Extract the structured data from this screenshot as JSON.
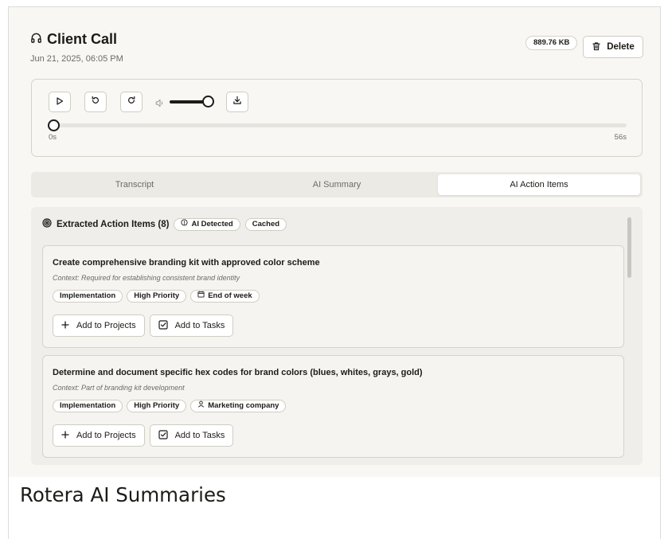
{
  "recording": {
    "title": "Client Call",
    "date": "Jun 21, 2025, 06:05 PM",
    "file_size": "889.76 KB",
    "delete_label": "Delete"
  },
  "player": {
    "time_start": "0s",
    "time_end": "56s",
    "volume_level": 0.9,
    "progress": 0
  },
  "tabs": [
    {
      "label": "Transcript",
      "active": false
    },
    {
      "label": "AI Summary",
      "active": false
    },
    {
      "label": "AI Action Items",
      "active": true
    }
  ],
  "action_items": {
    "heading": "Extracted Action Items (8)",
    "badges": [
      "AI Detected",
      "Cached"
    ],
    "items": [
      {
        "title": "Create comprehensive branding kit with approved color scheme",
        "context": "Context: Required for establishing consistent brand identity",
        "tags": [
          {
            "label": "Implementation",
            "icon": ""
          },
          {
            "label": "High Priority",
            "icon": ""
          },
          {
            "label": "End of week",
            "icon": "calendar-icon"
          }
        ],
        "add_projects_label": "Add to Projects",
        "add_tasks_label": "Add to Tasks"
      },
      {
        "title": "Determine and document specific hex codes for brand colors (blues, whites, grays, gold)",
        "context": "Context: Part of branding kit development",
        "tags": [
          {
            "label": "Implementation",
            "icon": ""
          },
          {
            "label": "High Priority",
            "icon": ""
          },
          {
            "label": "Marketing company",
            "icon": "user-icon"
          }
        ],
        "add_projects_label": "Add to Projects",
        "add_tasks_label": "Add to Tasks"
      }
    ]
  },
  "caption": "Rotera AI Summaries",
  "colors": {
    "background": "#f8f7f3",
    "text": "#1c1b17",
    "muted": "#6e6b63",
    "border": "#d6d3ca"
  }
}
